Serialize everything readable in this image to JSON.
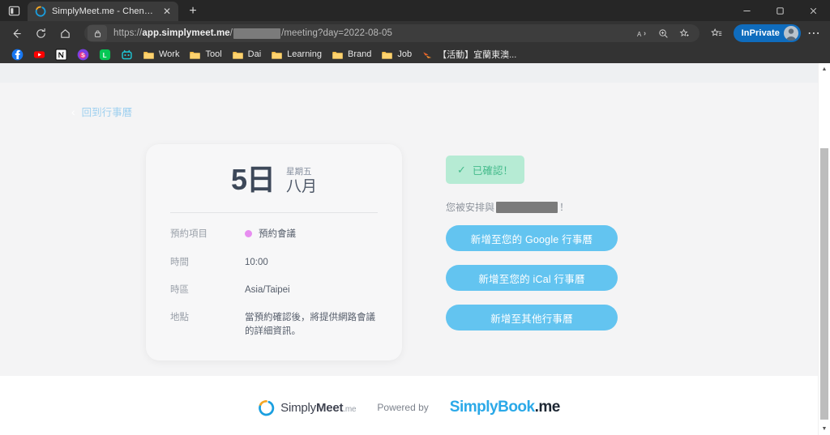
{
  "browser": {
    "tab": {
      "title": "SimplyMeet.me - Chen Yu Ting",
      "close_label": "✕",
      "favicon_name": "simplymeet-favicon"
    },
    "new_tab_label": "+",
    "window_controls": {
      "minimize": "—",
      "maximize": "☐",
      "close": "✕"
    },
    "nav": {
      "back": "←",
      "refresh": "⟳",
      "home": "⌂"
    },
    "address": {
      "scheme": "https://",
      "host": "app.simplymeet.me",
      "separator1": "/",
      "redacted": "",
      "path": "/meeting?day=2022-08-05",
      "lock_icon": "lock-icon"
    },
    "omnibox_actions": {
      "read_aloud": "Aᴺ",
      "zoom": "⊕",
      "add_favorite": "☆",
      "collections": "☆"
    },
    "profile": {
      "label": "InPrivate"
    },
    "more_label": "⋯",
    "bookmarks": [
      {
        "label": "",
        "icon": "facebook-icon"
      },
      {
        "label": "",
        "icon": "youtube-icon"
      },
      {
        "label": "",
        "icon": "notion-icon"
      },
      {
        "label": "",
        "icon": "shopee-icon"
      },
      {
        "label": "",
        "icon": "line-icon"
      },
      {
        "label": "",
        "icon": "robot-icon"
      },
      {
        "label": "Work",
        "icon": "folder-icon"
      },
      {
        "label": "Tool",
        "icon": "folder-icon"
      },
      {
        "label": "Dai",
        "icon": "folder-icon"
      },
      {
        "label": "Learning",
        "icon": "folder-icon"
      },
      {
        "label": "Brand",
        "icon": "folder-icon"
      },
      {
        "label": "Job",
        "icon": "folder-icon"
      },
      {
        "label": "【活動】宜蘭東澳...",
        "icon": "bird-icon"
      }
    ]
  },
  "page": {
    "back_link": {
      "label": "回到行事曆",
      "chevron": "‹"
    },
    "card": {
      "day": "5日",
      "weekday": "星期五",
      "month": "八月",
      "details": [
        {
          "label": "預約項目",
          "value": "預約會議",
          "has_dot": true,
          "dot_color": "#e78ef0"
        },
        {
          "label": "時間",
          "value": "10:00",
          "has_dot": false
        },
        {
          "label": "時區",
          "value": "Asia/Taipei",
          "has_dot": false
        },
        {
          "label": "地點",
          "value": "當預約確認後，將提供網路會議的詳細資訊。",
          "has_dot": false
        }
      ]
    },
    "status": {
      "badge_label": "已確認！",
      "tick": "✓"
    },
    "assignment": {
      "prefix": "您被安排與",
      "redacted_name": "",
      "suffix": "！"
    },
    "calendar_buttons": [
      {
        "label": "新增至您的 Google 行事曆"
      },
      {
        "label": "新增至您的 iCal 行事曆"
      },
      {
        "label": "新增至其他行事曆"
      }
    ],
    "footer": {
      "simplymeet_a": "Simply",
      "simplymeet_b": "Meet",
      "simplymeet_me": ".me",
      "powered_by": "Powered by",
      "simplybook_a": "implyBook",
      "simplybook_b": ".me",
      "simplybook_s": "S"
    }
  },
  "colors": {
    "button_blue": "#63c4f0",
    "badge_bg": "#b6ebd4",
    "badge_text": "#44bb8b",
    "dot_pink": "#e78ef0",
    "inprivate_blue": "#0f6cbd",
    "page_bg": "#f4f4f5",
    "card_bg": "#f7f7f8"
  },
  "scrollbar": {
    "up": "▲",
    "down": "▼"
  }
}
